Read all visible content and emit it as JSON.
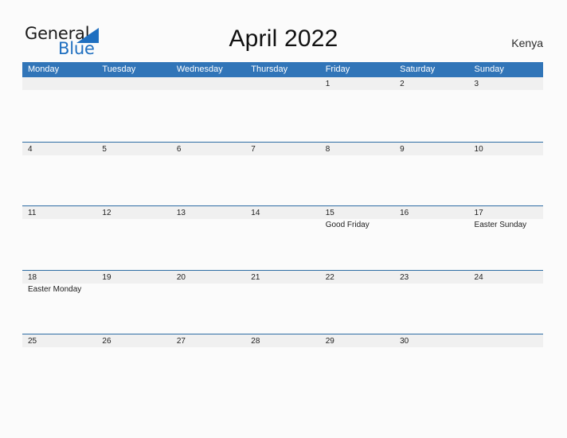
{
  "logo": {
    "word_one": "General",
    "word_two": "Blue",
    "triangle_icon": "triangle-icon",
    "accent_color": "#1f6fc0"
  },
  "header": {
    "title": "April 2022",
    "country": "Kenya"
  },
  "theme": {
    "header_blue": "#3175b8",
    "rule_blue": "#2e6da4",
    "band_gray": "#f0f0f0",
    "page_background": "#fbfbfb",
    "text_color": "#1d1d1d"
  },
  "calendar": {
    "weekdays": [
      "Monday",
      "Tuesday",
      "Wednesday",
      "Thursday",
      "Friday",
      "Saturday",
      "Sunday"
    ],
    "weeks": [
      {
        "rule": false,
        "days": [
          {
            "number": "",
            "event": ""
          },
          {
            "number": "",
            "event": ""
          },
          {
            "number": "",
            "event": ""
          },
          {
            "number": "",
            "event": ""
          },
          {
            "number": "1",
            "event": ""
          },
          {
            "number": "2",
            "event": ""
          },
          {
            "number": "3",
            "event": ""
          }
        ]
      },
      {
        "rule": true,
        "days": [
          {
            "number": "4",
            "event": ""
          },
          {
            "number": "5",
            "event": ""
          },
          {
            "number": "6",
            "event": ""
          },
          {
            "number": "7",
            "event": ""
          },
          {
            "number": "8",
            "event": ""
          },
          {
            "number": "9",
            "event": ""
          },
          {
            "number": "10",
            "event": ""
          }
        ]
      },
      {
        "rule": true,
        "days": [
          {
            "number": "11",
            "event": ""
          },
          {
            "number": "12",
            "event": ""
          },
          {
            "number": "13",
            "event": ""
          },
          {
            "number": "14",
            "event": ""
          },
          {
            "number": "15",
            "event": "Good Friday"
          },
          {
            "number": "16",
            "event": ""
          },
          {
            "number": "17",
            "event": "Easter Sunday"
          }
        ]
      },
      {
        "rule": true,
        "days": [
          {
            "number": "18",
            "event": "Easter Monday"
          },
          {
            "number": "19",
            "event": ""
          },
          {
            "number": "20",
            "event": ""
          },
          {
            "number": "21",
            "event": ""
          },
          {
            "number": "22",
            "event": ""
          },
          {
            "number": "23",
            "event": ""
          },
          {
            "number": "24",
            "event": ""
          }
        ]
      },
      {
        "rule": true,
        "days": [
          {
            "number": "25",
            "event": ""
          },
          {
            "number": "26",
            "event": ""
          },
          {
            "number": "27",
            "event": ""
          },
          {
            "number": "28",
            "event": ""
          },
          {
            "number": "29",
            "event": ""
          },
          {
            "number": "30",
            "event": ""
          },
          {
            "number": "",
            "event": ""
          }
        ]
      }
    ]
  }
}
